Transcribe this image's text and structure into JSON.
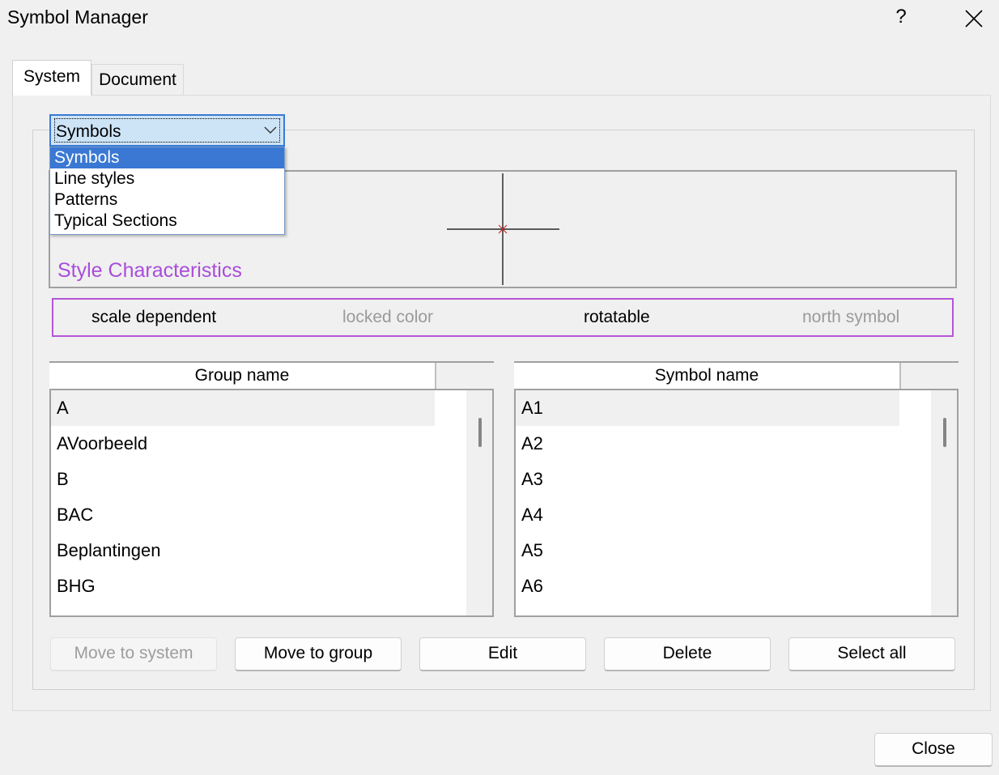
{
  "window": {
    "title": "Symbol Manager",
    "help_label": "?"
  },
  "tabs": [
    {
      "label": "System",
      "active": true
    },
    {
      "label": "Document",
      "active": false
    }
  ],
  "type_dropdown": {
    "selected": "Symbols",
    "options": [
      "Symbols",
      "Line styles",
      "Patterns",
      "Typical Sections"
    ],
    "expanded": true
  },
  "preview": {
    "section_title": "Style Characteristics",
    "title_color": "#a94ddb"
  },
  "characteristics": [
    {
      "label": "scale dependent",
      "enabled": true
    },
    {
      "label": "locked color",
      "enabled": false
    },
    {
      "label": "rotatable",
      "enabled": true
    },
    {
      "label": "north symbol",
      "enabled": false
    }
  ],
  "group_list": {
    "header": "Group name",
    "rows": [
      "A",
      "AVoorbeeld",
      "B",
      "BAC",
      "Beplantingen",
      "BHG"
    ],
    "selected_index": 0
  },
  "symbol_list": {
    "header": "Symbol name",
    "rows": [
      "A1",
      "A2",
      "A3",
      "A4",
      "A5",
      "A6"
    ],
    "selected_index": 0
  },
  "actions": {
    "move_to_system": "Move to system",
    "move_to_group": "Move to group",
    "edit": "Edit",
    "delete": "Delete",
    "select_all": "Select all"
  },
  "footer": {
    "close_label": "Close"
  },
  "colors": {
    "accent": "#3a78d4",
    "characteristics_border": "#b455d8"
  }
}
